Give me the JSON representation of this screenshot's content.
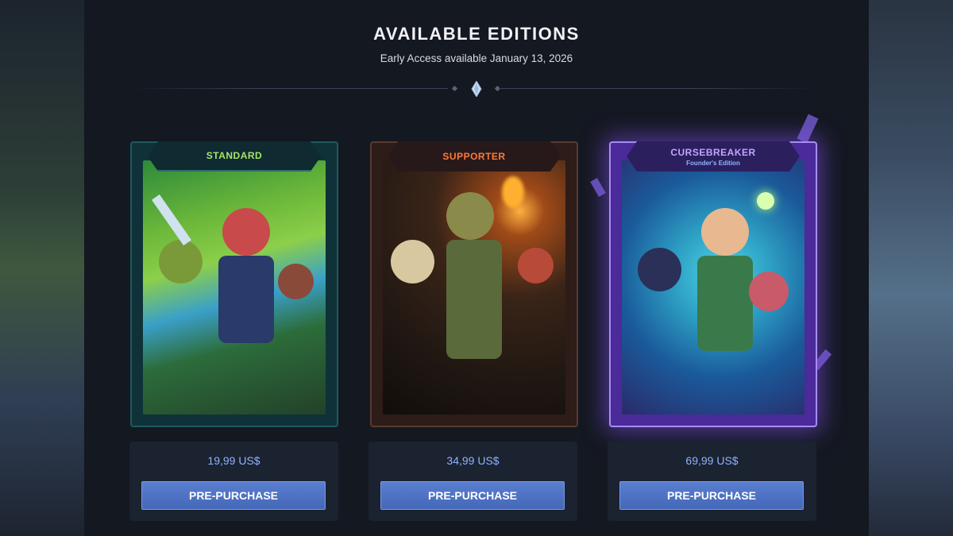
{
  "header": {
    "title": "AVAILABLE EDITIONS",
    "subtitle": "Early Access available January 13, 2026"
  },
  "editions": [
    {
      "name": "STANDARD",
      "subtitle": "",
      "price": "19,99 US$",
      "button_label": "PRE-PURCHASE",
      "accent": "#a7e36a"
    },
    {
      "name": "SUPPORTER",
      "subtitle": "",
      "price": "34,99 US$",
      "button_label": "PRE-PURCHASE",
      "accent": "#ff7a3a"
    },
    {
      "name": "CURSEBREAKER",
      "subtitle": "Founder's Edition",
      "price": "69,99 US$",
      "button_label": "PRE-PURCHASE",
      "accent": "#c4a2ff"
    }
  ],
  "colors": {
    "button": "#4a6cbf",
    "price_text": "#8fb2ff",
    "background": "#141821"
  },
  "icons": {
    "divider": "diamond-gem-icon"
  }
}
